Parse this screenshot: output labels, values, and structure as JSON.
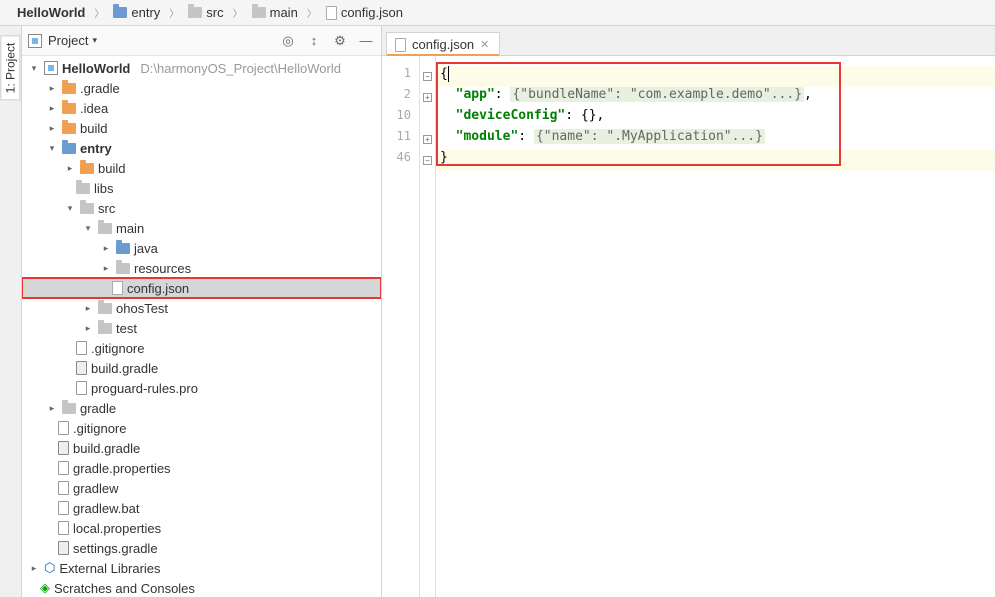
{
  "breadcrumb": [
    {
      "label": "HelloWorld",
      "bold": true,
      "icon": ""
    },
    {
      "label": "entry",
      "icon": "folder-blue"
    },
    {
      "label": "src",
      "icon": "folder"
    },
    {
      "label": "main",
      "icon": "folder"
    },
    {
      "label": "config.json",
      "icon": "file-json"
    }
  ],
  "panel": {
    "title": "Project",
    "selector_caret": "▾"
  },
  "side_tab": "1: Project",
  "tree_root": {
    "name": "HelloWorld",
    "path": "D:\\harmonyOS_Project\\HelloWorld"
  },
  "tree": {
    "gradle_dir": ".gradle",
    "idea_dir": ".idea",
    "build_dir": "build",
    "entry_dir": "entry",
    "entry_build": "build",
    "entry_libs": "libs",
    "entry_src": "src",
    "src_main": "main",
    "main_java": "java",
    "main_resources": "resources",
    "main_config": "config.json",
    "src_ohos": "ohosTest",
    "src_test": "test",
    "entry_gitignore": ".gitignore",
    "entry_buildgradle": "build.gradle",
    "entry_proguard": "proguard-rules.pro",
    "gradle_dir2": "gradle",
    "root_gitignore": ".gitignore",
    "root_buildgradle": "build.gradle",
    "root_gradleprops": "gradle.properties",
    "root_gradlew": "gradlew",
    "root_gradlewbat": "gradlew.bat",
    "root_localprops": "local.properties",
    "root_settings": "settings.gradle",
    "ext_libs": "External Libraries",
    "scratches": "Scratches and Consoles"
  },
  "editor": {
    "tab_label": "config.json",
    "gutter": [
      "1",
      "2",
      "10",
      "11",
      "46"
    ],
    "code": {
      "l1": "{",
      "l2_key": "\"app\"",
      "l2_val": "{\"bundleName\": \"com.example.demo\"...}",
      "l2_end": ",",
      "l3_key": "\"deviceConfig\"",
      "l3_val": "{}",
      "l3_end": ",",
      "l4_key": "\"module\"",
      "l4_val": "{\"name\": \".MyApplication\"...}",
      "l5": "}"
    }
  }
}
